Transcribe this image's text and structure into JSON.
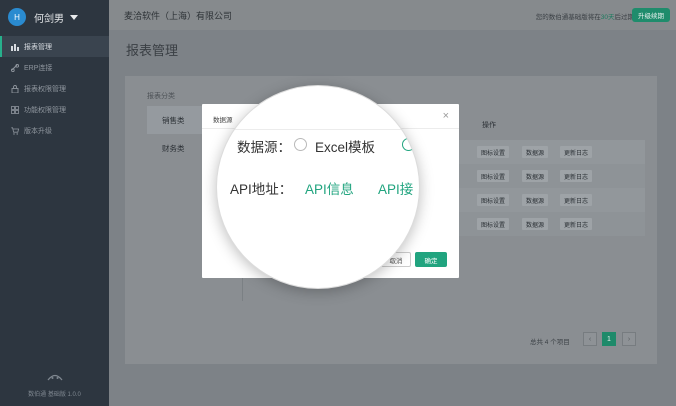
{
  "sidebar": {
    "user": {
      "initial": "H",
      "name": "何剑男"
    },
    "items": [
      {
        "label": "报表管理",
        "icon": "bar-chart-icon",
        "active": true
      },
      {
        "label": "ERP连接",
        "icon": "link-icon",
        "active": false
      },
      {
        "label": "报表权限管理",
        "icon": "lock-icon",
        "active": false
      },
      {
        "label": "功能权限管理",
        "icon": "grid-icon",
        "active": false
      },
      {
        "label": "版本升级",
        "icon": "cart-icon",
        "active": false
      }
    ],
    "footer": "数伯通 基础版 1.0.0"
  },
  "header": {
    "company": "麦洽软件（上海）有限公司",
    "expiry_prefix": "您的数伯通基础版将在",
    "expiry_days": "30天",
    "expiry_suffix": "后过期",
    "upgrade_label": "升级续期"
  },
  "page": {
    "title": "报表管理"
  },
  "category": {
    "label": "报表分类",
    "items": [
      "销售类",
      "财务类"
    ]
  },
  "table": {
    "ops_header": "操作",
    "rows": [
      {
        "ops": [
          "图标设置",
          "数据源",
          "更新日志"
        ]
      },
      {
        "ops": [
          "图标设置",
          "数据源",
          "更新日志"
        ]
      },
      {
        "ops": [
          "图标设置",
          "数据源",
          "更新日志"
        ]
      },
      {
        "ops": [
          "图标设置",
          "数据源",
          "更新日志"
        ]
      }
    ]
  },
  "pagination": {
    "total": "总共 4 个项目",
    "current": "1",
    "prev": "‹",
    "next": "›"
  },
  "modal": {
    "title": "数据源",
    "close": "×",
    "cancel_label": "取消",
    "ok_label": "确定",
    "source_label": "数据源：",
    "source_option": "Excel模板",
    "api_label": "API地址：",
    "api_info": "API信息",
    "api_link_partial": "API接"
  },
  "colors": {
    "accent": "#21a47f",
    "sidebar": "#2d3640"
  }
}
